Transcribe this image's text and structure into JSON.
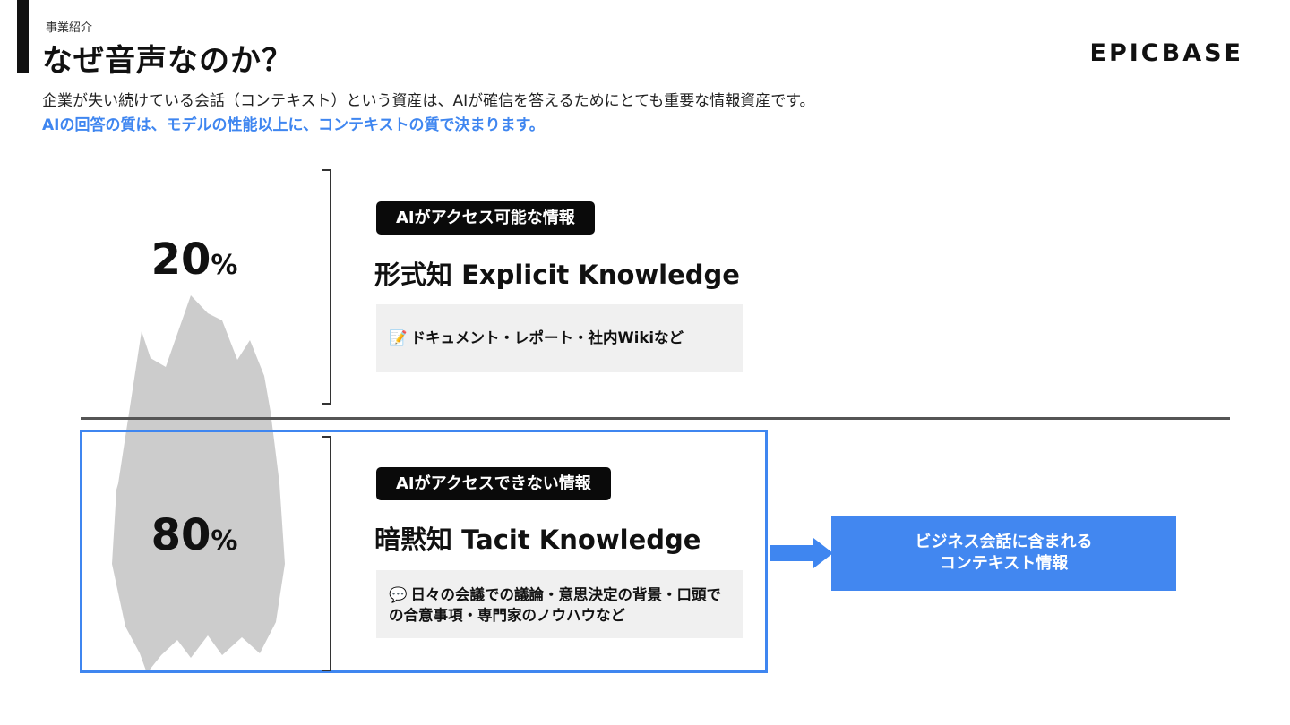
{
  "header": {
    "section_label": "事業紹介",
    "title": "なぜ音声なのか？",
    "logo_text": "EPICBASE",
    "intro": "企業が失い続けている会話（コンテキスト）という資産は、AIが確信を答えるためにとても重要な情報資産です。",
    "highlight": "AIの回答の質は、モデルの性能以上に、コンテキストの質で決まります。"
  },
  "explicit": {
    "percent_value": "20",
    "percent_sign": "%",
    "tag": "AIがアクセス可能な情報",
    "title": "形式知 Explicit Knowledge",
    "example_icon": "memo-icon",
    "example_glyph": "📝",
    "example_text": "ドキュメント・レポート・社内Wikiなど"
  },
  "tacit": {
    "percent_value": "80",
    "percent_sign": "%",
    "tag": "AIがアクセスできない情報",
    "title": "暗黙知 Tacit Knowledge",
    "example_icon": "speech-bubble-icon",
    "example_glyph": "💬",
    "example_text": "日々の会議での議論・意思決定の背景・口頭での合意事項・専門家のノウハウなど"
  },
  "callout": {
    "line1": "ビジネス会話に含まれる",
    "line2": "コンテキスト情報"
  },
  "colors": {
    "accent": "#3f86f0",
    "callout": "#4287f0",
    "iceberg": "#cccccc",
    "example_bg": "#f0f0f0"
  }
}
